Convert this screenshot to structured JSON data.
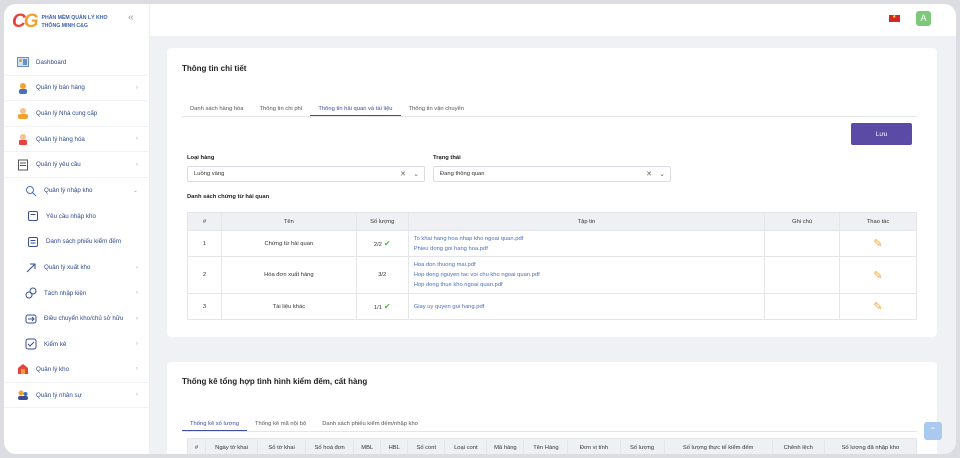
{
  "app": {
    "logo_text_1": "PHẦN MỀM QUẢN LÝ KHO",
    "logo_text_2": "THÔNG MINH C&G",
    "avatar_letter": "A"
  },
  "sidebar": {
    "items": [
      {
        "label": "Dashboard",
        "icon": "dashboard-icon"
      },
      {
        "label": "Quản lý bán hàng",
        "icon": "sales-icon"
      },
      {
        "label": "Quản lý Nhà cung cấp",
        "icon": "supplier-icon"
      },
      {
        "label": "Quản lý hàng hóa",
        "icon": "goods-icon"
      },
      {
        "label": "Quản lý yêu cầu",
        "icon": "request-icon"
      },
      {
        "label": "Quản lý nhập kho",
        "icon": "import-icon"
      },
      {
        "label": "Yêu cầu nhập kho",
        "icon": "doc-icon"
      },
      {
        "label": "Danh sách phiếu kiểm đếm",
        "icon": "list-icon"
      },
      {
        "label": "Quản lý xuất kho",
        "icon": "export-icon"
      },
      {
        "label": "Tách nhập kiện",
        "icon": "split-icon"
      },
      {
        "label": "Điều chuyển kho/chủ sở hữu",
        "icon": "transfer-icon"
      },
      {
        "label": "Kiểm kê",
        "icon": "inventory-icon"
      },
      {
        "label": "Quản lý kho",
        "icon": "warehouse-icon"
      },
      {
        "label": "Quản lý nhân sự",
        "icon": "staff-icon"
      }
    ]
  },
  "detail": {
    "title": "Thông tin chi tiết",
    "tabs": [
      "Danh sách hàng hóa",
      "Thông tin chi phí",
      "Thông tin hải quan và tài liệu",
      "Thông tin vận chuyển"
    ],
    "save_label": "Lưu",
    "loai_hang_label": "Loại hàng",
    "loai_hang_value": "Luồng vàng",
    "trang_thai_label": "Trạng thái",
    "trang_thai_value": "Đang thông quan",
    "section_label": "Danh sách chứng từ hải quan",
    "columns": [
      "#",
      "Tên",
      "Số lượng",
      "Tập tin",
      "Ghi chú",
      "Thao tác"
    ],
    "rows": [
      {
        "no": "1",
        "name": "Chứng từ hải quan",
        "qty": "2/2",
        "done": true,
        "files": [
          "To khai hang hoa nhap kho ngoai quan.pdf",
          "Phieu dong goi hang hoa.pdf"
        ]
      },
      {
        "no": "2",
        "name": "Hóa đơn xuất hàng",
        "qty": "3/2",
        "done": false,
        "files": [
          "Hoa don thuong mai.pdf",
          "Hop dong nguyen tac voi chu kho ngoai quan.pdf",
          "Hop dong thue kho ngoai quan.pdf"
        ]
      },
      {
        "no": "3",
        "name": "Tài liệu khác",
        "qty": "1/1",
        "done": true,
        "files": [
          "Giay uy quyen gui hang.pdf"
        ]
      }
    ]
  },
  "summary": {
    "title": "Thống kê tổng hợp tình hình kiểm đếm, cất hàng",
    "tabs": [
      "Thống kê số lượng",
      "Thống kê mã nội bộ",
      "Danh sách phiếu kiểm đếm/nhập kho"
    ],
    "columns": [
      "#",
      "Ngày tờ khai",
      "Số tờ khai",
      "Số hoá đơn",
      "MBL",
      "HBL",
      "Số cont",
      "Loại cont",
      "Mã hàng",
      "Tên Hàng",
      "Đơn vị tính",
      "Số lượng",
      "Số lượng thực tế kiểm đếm",
      "Chênh lệch",
      "Số lượng đã nhập kho"
    ]
  },
  "colors": {
    "accent": "#5b4aa6",
    "link": "#4a6fbf",
    "check": "#4cbf3a",
    "edit": "#f1a43a"
  }
}
